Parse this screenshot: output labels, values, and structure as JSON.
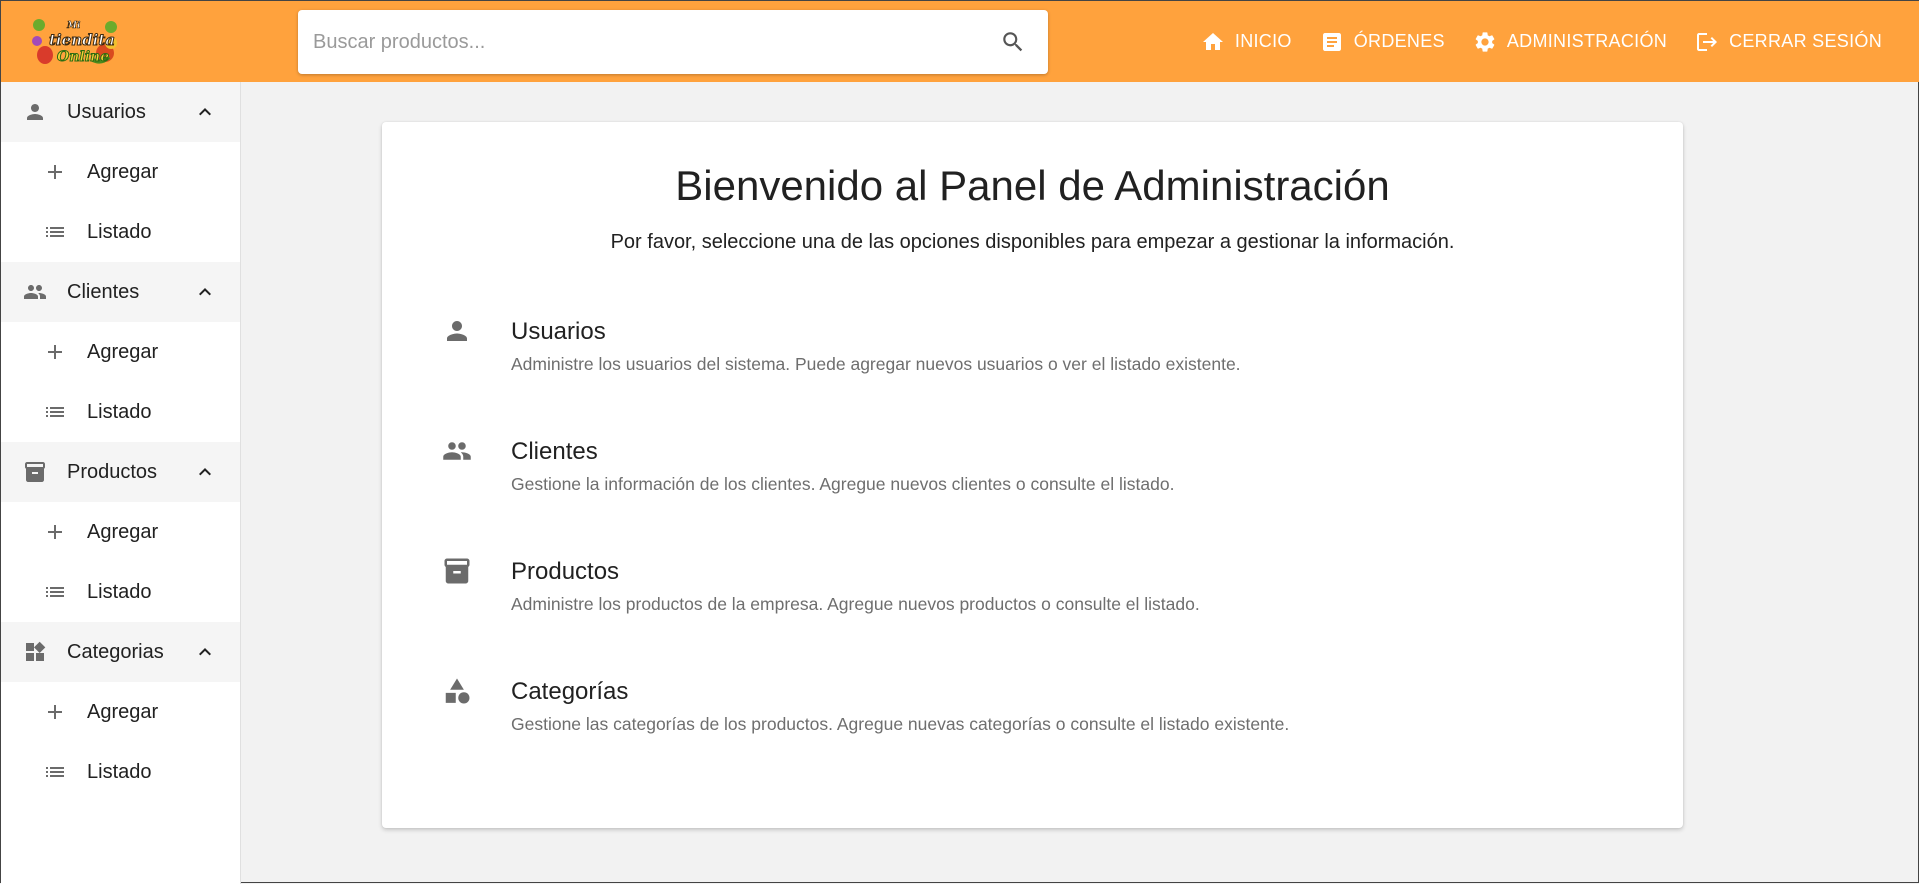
{
  "colors": {
    "topbar": "#ffa23d",
    "icon_gray": "#6b6b6b"
  },
  "logo": {
    "text_line1": "Mi",
    "text_line2": "tiendita",
    "text_line3": "Online"
  },
  "search": {
    "placeholder": "Buscar productos...",
    "icon": "search-icon"
  },
  "nav": [
    {
      "label": "INICIO",
      "icon": "home-icon"
    },
    {
      "label": "ÓRDENES",
      "icon": "receipt-icon"
    },
    {
      "label": "ADMINISTRACIÓN",
      "icon": "gear-icon"
    },
    {
      "label": "CERRAR SESIÓN",
      "icon": "logout-icon"
    }
  ],
  "sidebar": {
    "groups": [
      {
        "label": "Usuarios",
        "icon": "person-icon",
        "items": [
          {
            "label": "Agregar",
            "icon": "plus-icon"
          },
          {
            "label": "Listado",
            "icon": "list-icon"
          }
        ]
      },
      {
        "label": "Clientes",
        "icon": "people-icon",
        "items": [
          {
            "label": "Agregar",
            "icon": "plus-icon"
          },
          {
            "label": "Listado",
            "icon": "list-icon"
          }
        ]
      },
      {
        "label": "Productos",
        "icon": "archive-icon",
        "items": [
          {
            "label": "Agregar",
            "icon": "plus-icon"
          },
          {
            "label": "Listado",
            "icon": "list-icon"
          }
        ]
      },
      {
        "label": "Categorias",
        "icon": "widgets-icon",
        "items": [
          {
            "label": "Agregar",
            "icon": "plus-icon"
          },
          {
            "label": "Listado",
            "icon": "list-icon"
          }
        ]
      }
    ]
  },
  "main": {
    "title": "Bienvenido al Panel de Administración",
    "subtitle": "Por favor, seleccione una de las opciones disponibles para empezar a gestionar la información.",
    "options": [
      {
        "title": "Usuarios",
        "description": "Administre los usuarios del sistema. Puede agregar nuevos usuarios o ver el listado existente.",
        "icon": "person-icon"
      },
      {
        "title": "Clientes",
        "description": "Gestione la información de los clientes. Agregue nuevos clientes o consulte el listado.",
        "icon": "people-icon"
      },
      {
        "title": "Productos",
        "description": "Administre los productos de la empresa. Agregue nuevos productos o consulte el listado.",
        "icon": "archive-icon"
      },
      {
        "title": "Categorías",
        "description": "Gestione las categorías de los productos. Agregue nuevas categorías o consulte el listado existente.",
        "icon": "category-icon"
      }
    ]
  }
}
